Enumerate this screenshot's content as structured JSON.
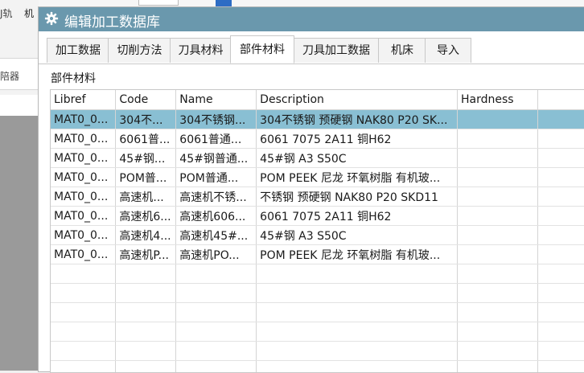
{
  "background": {
    "left_label_a": "J轨",
    "left_label_b": "机",
    "left_label_c": "陪器"
  },
  "dialog": {
    "title": "编辑加工数据库",
    "title_icon": "gear-icon",
    "accent_color": "#6a98ad",
    "tabs": [
      {
        "label": "加工数据"
      },
      {
        "label": "切削方法"
      },
      {
        "label": "刀具材料"
      },
      {
        "label": "部件材料"
      },
      {
        "label": "刀具加工数据"
      },
      {
        "label": "机床"
      },
      {
        "label": "导入"
      }
    ],
    "active_tab": "部件材料",
    "section_label": "部件材料",
    "table": {
      "columns": [
        "Libref",
        "Code",
        "Name",
        "Description",
        "Hardness"
      ],
      "rows": [
        {
          "libref": "MAT0_0...",
          "code": "304不...",
          "name": "304不锈钢...",
          "description": "304不锈钢 预硬钢 NAK80 P20 SK...",
          "hardness": ""
        },
        {
          "libref": "MAT0_0...",
          "code": "6061普...",
          "name": "6061普通...",
          "description": "6061 7075 2A11 铜H62",
          "hardness": ""
        },
        {
          "libref": "MAT0_0...",
          "code": "45#钢...",
          "name": "45#钢普通...",
          "description": "45#钢 A3 S50C",
          "hardness": ""
        },
        {
          "libref": "MAT0_0...",
          "code": "POM普...",
          "name": "POM普通...",
          "description": "POM PEEK 尼龙 环氧树脂 有机玻...",
          "hardness": ""
        },
        {
          "libref": "MAT0_0...",
          "code": "高速机...",
          "name": "高速机不锈...",
          "description": "不锈钢 预硬钢 NAK80 P20 SKD11",
          "hardness": ""
        },
        {
          "libref": "MAT0_0...",
          "code": "高速机6...",
          "name": "高速机606...",
          "description": "6061 7075 2A11 铜H62",
          "hardness": ""
        },
        {
          "libref": "MAT0_0...",
          "code": "高速机4...",
          "name": "高速机45#...",
          "description": "45#钢 A3 S50C",
          "hardness": ""
        },
        {
          "libref": "MAT0_0...",
          "code": "高速机P...",
          "name": "高速机PO...",
          "description": "POM PEEK 尼龙 环氧树脂 有机玻...",
          "hardness": ""
        }
      ],
      "selected_row": 0,
      "selection_color": "#89bfd3"
    }
  }
}
